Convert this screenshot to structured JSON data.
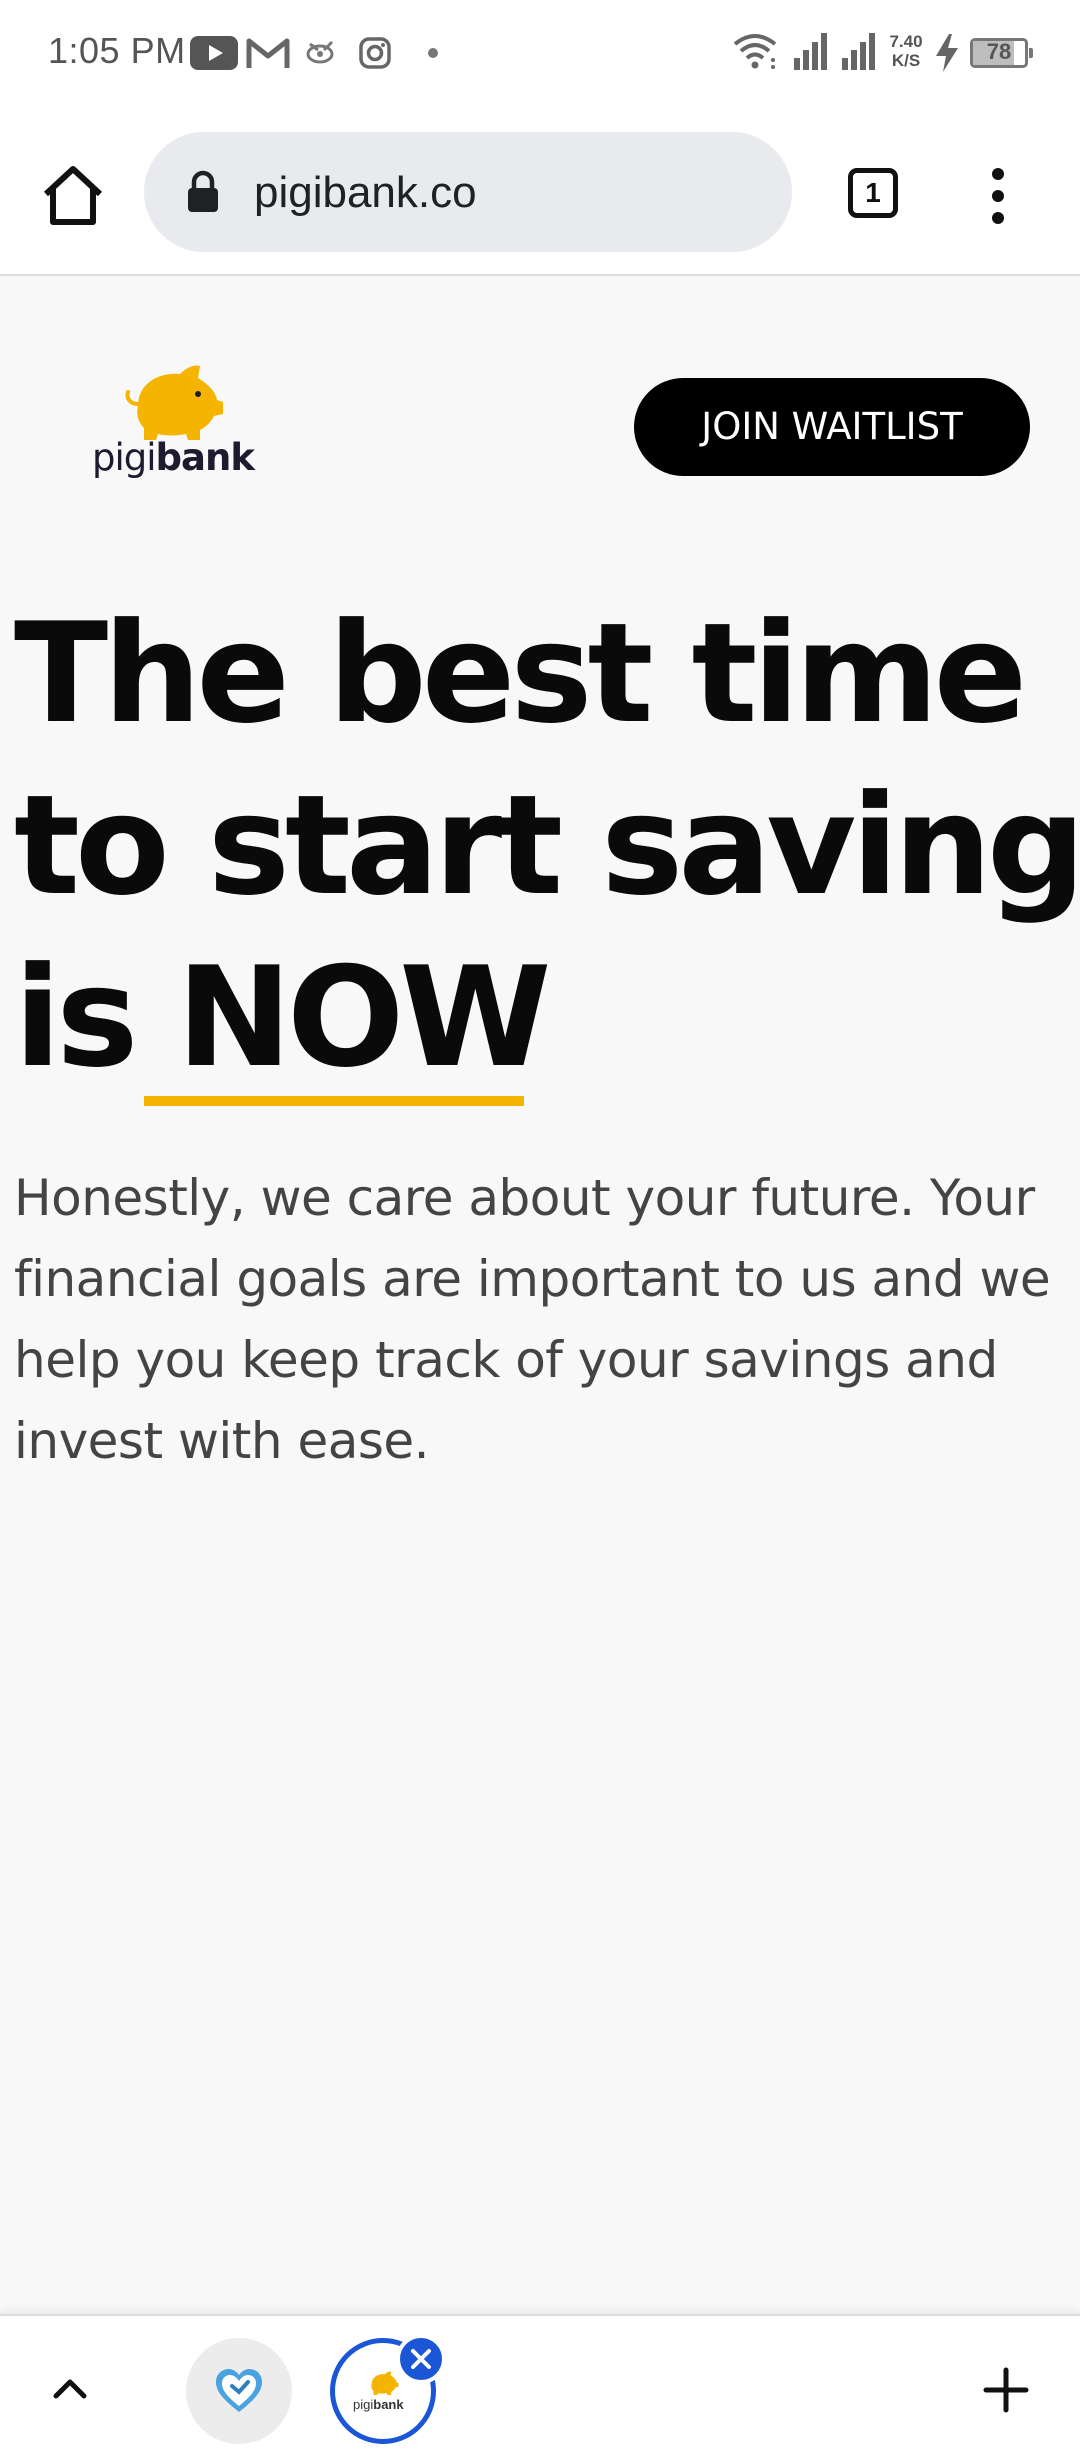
{
  "status_bar": {
    "time": "1:05 PM",
    "network_speed_value": "7.40",
    "network_speed_unit": "K/S",
    "battery_level": "78",
    "notification_icons": [
      "youtube-icon",
      "gmail-icon",
      "app-notification-icon",
      "instagram-icon",
      "more-dot-icon"
    ],
    "system_icons": [
      "wifi-icon",
      "signal-icon",
      "signal-icon",
      "charging-icon",
      "battery-icon"
    ]
  },
  "browser": {
    "url": "pigibank.co",
    "tab_count": "1"
  },
  "page": {
    "logo": {
      "light": "pigi",
      "bold": "bank"
    },
    "cta_label": "JOIN WAITLIST",
    "headline": {
      "line1": "The best time",
      "line2": "to start saving",
      "line3_prefix": "is ",
      "line3_highlight": "NOW"
    },
    "description": "Honestly, we care about your future. Your financial goals are important to us and we help you keep track of your savings and invest with ease.",
    "accent_color": "#f4b400"
  },
  "bottom_tabs": {
    "mini_logo_light": "pigi",
    "mini_logo_bold": "bank",
    "active_tab_color": "#1a56d6"
  }
}
